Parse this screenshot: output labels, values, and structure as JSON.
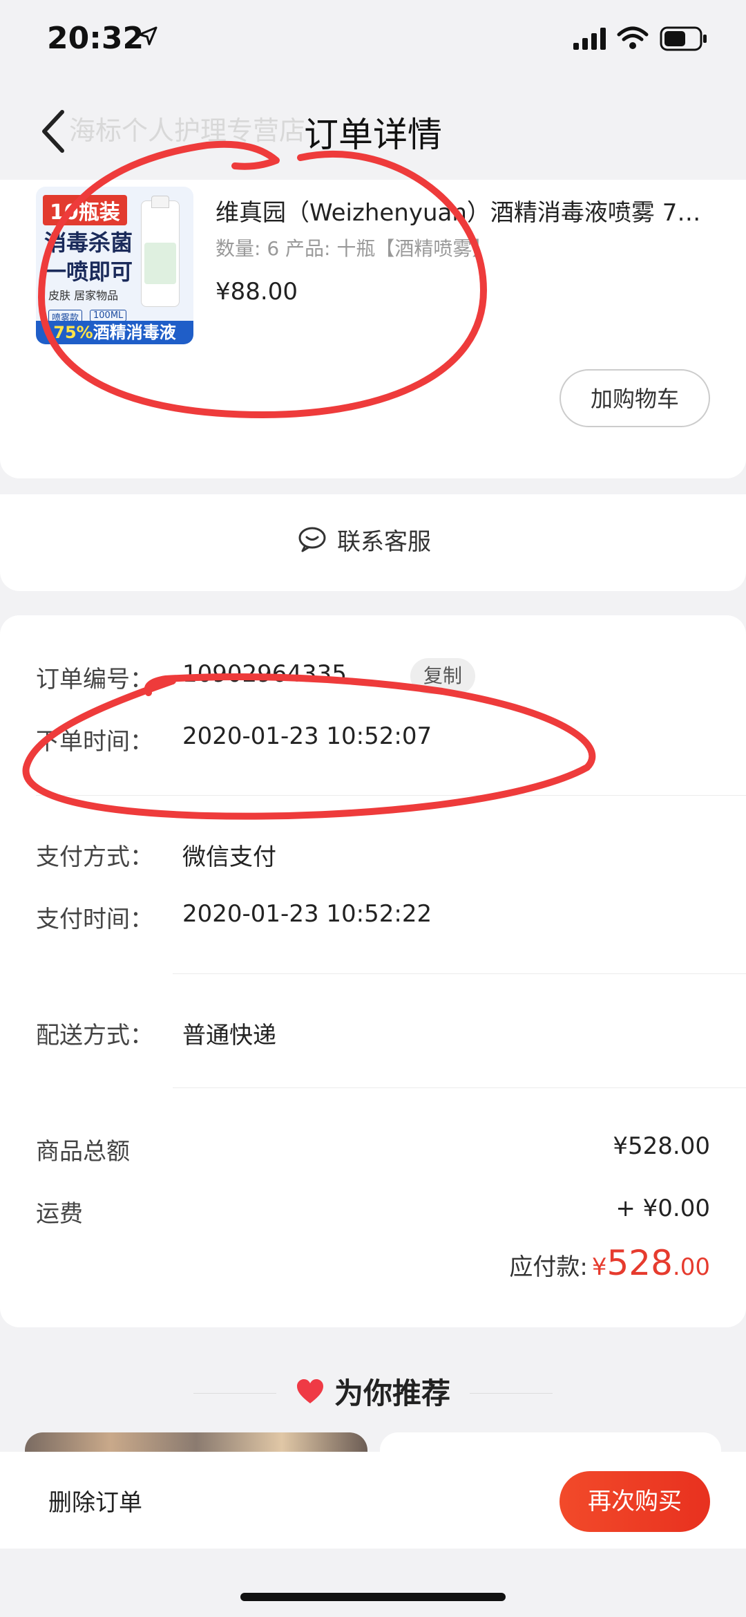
{
  "status_bar": {
    "time": "20:32",
    "location_icon": "location-arrow-icon",
    "signal_icon": "cellular-signal-icon",
    "wifi_icon": "wifi-icon",
    "battery_icon": "battery-icon"
  },
  "header": {
    "title": "订单详情",
    "shop_name": "海标个人护理专营店",
    "back_icon": "chevron-left-icon"
  },
  "product": {
    "name": "维真园（Weizhenyuan）酒精消毒液喷雾 75...",
    "spec": "数量: 6  产品: 十瓶【酒精喷雾】",
    "price": "¥88.00",
    "add_to_cart": "加购物车",
    "image_text": {
      "tag": "10瓶装",
      "line1": "消毒杀菌",
      "line2": "一喷即可",
      "line3": "皮肤 居家物品",
      "chip1": "喷雾款",
      "chip2": "100ML",
      "band_pct": "75%",
      "band_text": "酒精消毒液"
    }
  },
  "service": {
    "label": "联系客服",
    "icon": "chat-bubble-icon"
  },
  "order": {
    "number_label": "订单编号：",
    "number_value": "10902964335",
    "copy": "复制",
    "time_label": "下单时间：",
    "time_value": "2020-01-23 10:52:07",
    "pay_method_label": "支付方式：",
    "pay_method_value": "微信支付",
    "pay_time_label": "支付时间：",
    "pay_time_value": "2020-01-23 10:52:22",
    "delivery_label": "配送方式：",
    "delivery_value": "普通快递"
  },
  "amounts": {
    "goods_total_label": "商品总额",
    "goods_total_value": "¥528.00",
    "shipping_label": "运费",
    "shipping_value": "+ ¥0.00",
    "payable_label": "应付款:",
    "payable_currency": "¥",
    "payable_int": "528",
    "payable_dec": ".00"
  },
  "recommend": {
    "title": "为你推荐",
    "icon": "heart-icon"
  },
  "bottom": {
    "delete": "删除订单",
    "rebuy": "再次购买"
  },
  "colors": {
    "accent_red": "#e63b2e",
    "annotation_red": "#ee3b3b"
  }
}
